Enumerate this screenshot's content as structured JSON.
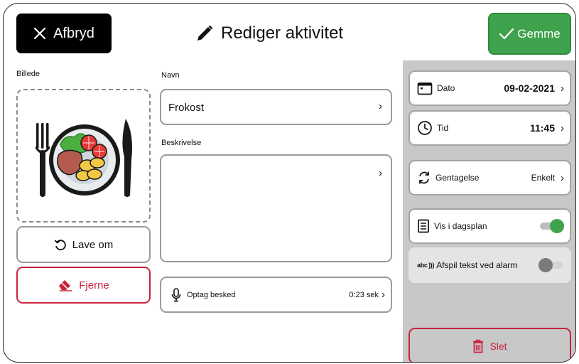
{
  "header": {
    "cancel_label": "Afbryd",
    "title": "Rediger aktivitet",
    "save_label": "Gemme"
  },
  "image_section": {
    "label": "Billede",
    "redo_label": "Lave om",
    "remove_label": "Fjerne"
  },
  "name_section": {
    "label": "Navn",
    "value": "Frokost"
  },
  "description_section": {
    "label": "Beskrivelse",
    "value": ""
  },
  "record": {
    "label": "Optag besked",
    "duration": "0:23 sek"
  },
  "settings": {
    "date_label": "Dato",
    "date_value": "09-02-2021",
    "time_label": "Tid",
    "time_value": "11:45",
    "repeat_label": "Gentagelse",
    "repeat_value": "Enkelt",
    "show_label": "Vis i dagsplan",
    "show_on": true,
    "tts_icon_text": "abc )))",
    "tts_label": "Afspil tekst ved alarm",
    "tts_on": false,
    "delete_label": "Slet"
  },
  "chevron": "›",
  "colors": {
    "accent_green": "#3fa34d",
    "danger_red": "#c8233d",
    "panel_gray": "#c8c8c8"
  }
}
